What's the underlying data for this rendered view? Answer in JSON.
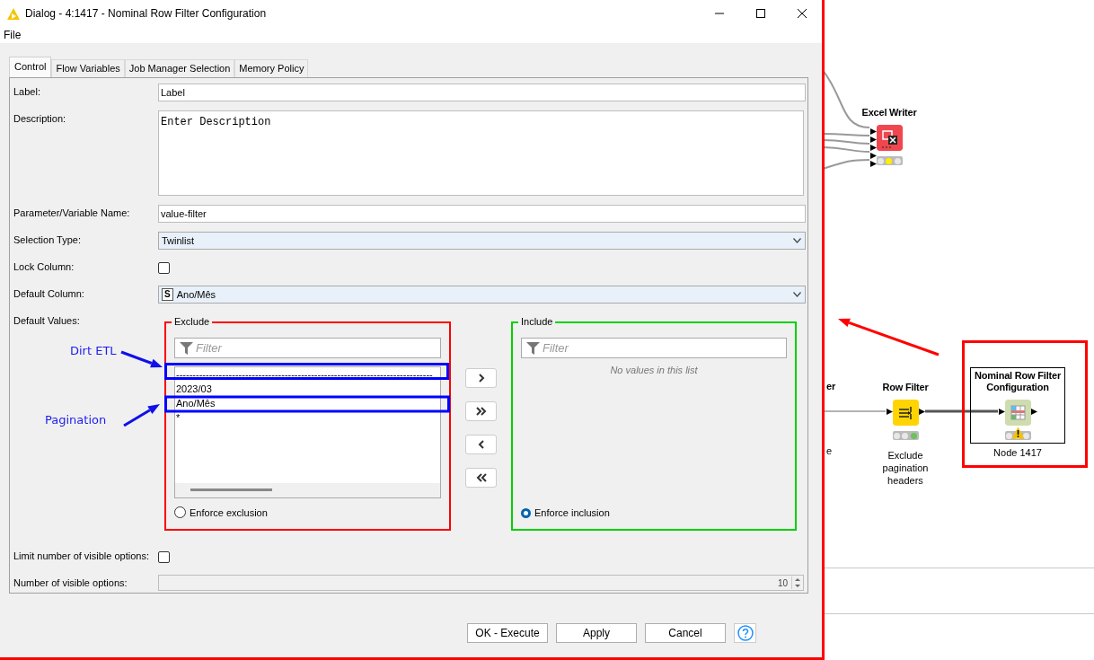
{
  "window": {
    "title": "Dialog - 4:1417 - Nominal Row Filter Configuration",
    "menu": [
      "File"
    ]
  },
  "tabs": [
    {
      "label": "Control",
      "selected": true
    },
    {
      "label": "Flow Variables",
      "selected": false
    },
    {
      "label": "Job Manager Selection",
      "selected": false
    },
    {
      "label": "Memory Policy",
      "selected": false
    }
  ],
  "fields": [
    {
      "kind": "text",
      "label": "Label:",
      "value": "Label"
    },
    {
      "kind": "textarea",
      "label": "Description:",
      "value": "Enter Description"
    },
    {
      "kind": "text",
      "label": "Parameter/Variable Name:",
      "value": "value-filter"
    },
    {
      "kind": "combo",
      "label": "Selection Type:",
      "value": "Twinlist"
    },
    {
      "kind": "checkbox",
      "label": "Lock Column:",
      "checked": false
    },
    {
      "kind": "combo",
      "label": "Default Column:",
      "value": "Ano/Mês",
      "badge": "S"
    },
    {
      "kind": "twinlist",
      "label": "Default Values:",
      "exclude": {
        "title": "Exclude",
        "placeholder": "Filter",
        "items": [
          {
            "label": "------------------------------------------------------------------------------",
            "selected": false
          },
          {
            "label": "2023/03",
            "selected": false
          },
          {
            "label": "Ano/Mês",
            "selected": false
          },
          {
            "label": "*",
            "selected": false
          }
        ],
        "enforce": {
          "label": "Enforce exclusion",
          "selected": false
        }
      },
      "move_buttons": [
        {
          "kind": "add"
        },
        {
          "kind": "add_all"
        },
        {
          "kind": "remove"
        },
        {
          "kind": "remove_all"
        }
      ],
      "include": {
        "title": "Include",
        "placeholder": "Filter",
        "empty_message": "No values in this list",
        "enforce": {
          "label": "Enforce inclusion",
          "selected": true
        }
      }
    },
    {
      "kind": "checkbox",
      "label": "Limit number of visible options:",
      "checked": false
    },
    {
      "kind": "spinner",
      "label": "Number of visible options:",
      "value": "10",
      "disabled": true
    }
  ],
  "buttons": [
    {
      "kind": "text",
      "label": "OK - Execute"
    },
    {
      "kind": "text",
      "label": "Apply"
    },
    {
      "kind": "text",
      "label": "Cancel"
    },
    {
      "kind": "help"
    }
  ],
  "annotations": [
    {
      "text": "Dirt ETL"
    },
    {
      "text": "Pagination"
    }
  ],
  "workflow": {
    "nodes": [
      {
        "kind": "partial",
        "label": "er",
        "caption": "e"
      },
      {
        "kind": "excel_writer",
        "label": "Excel Writer",
        "executed": false,
        "warning": false,
        "selected": false
      },
      {
        "kind": "row_filter",
        "label": "Row Filter",
        "caption": "Exclude pagination headers",
        "executed": true,
        "warning": false,
        "selected": false
      },
      {
        "kind": "nominal",
        "label": "Nominal Row Filter Configuration",
        "caption": "Node 1417",
        "executed": false,
        "warning": true,
        "selected": true
      }
    ]
  }
}
